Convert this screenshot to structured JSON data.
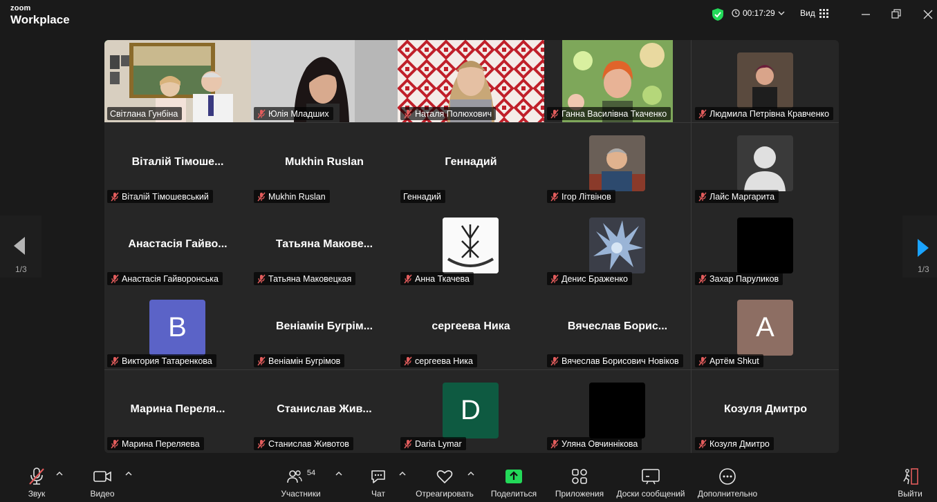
{
  "app": {
    "logo_line1": "zoom",
    "logo_line2": "Workplace"
  },
  "titlebar": {
    "timer": "00:17:29",
    "view_label": "Вид"
  },
  "nav": {
    "prev_page": "1/3",
    "next_page": "1/3"
  },
  "colors": {
    "active_speaker": "#23d959",
    "mute_icon": "#e25c5c",
    "share_button": "#23d959"
  },
  "participants": [
    {
      "name": "Світлана Гунбіна",
      "muted": false,
      "type": "video",
      "active": true
    },
    {
      "name": "Юлія Младших",
      "muted": true,
      "type": "video"
    },
    {
      "name": "Наталя Полюхович",
      "muted": true,
      "type": "video"
    },
    {
      "name": "Ганна Василівна Ткаченко",
      "muted": true,
      "type": "video"
    },
    {
      "name": "Людмила Петрівна Кравченко",
      "muted": true,
      "type": "photo"
    },
    {
      "name": "Віталій Тімошевський",
      "display": "Віталій Тімоше...",
      "muted": true,
      "type": "name"
    },
    {
      "name": "Mukhin Ruslan",
      "display": "Mukhin Ruslan",
      "muted": true,
      "type": "name"
    },
    {
      "name": "Геннадий",
      "display": "Геннадий",
      "muted": false,
      "type": "name"
    },
    {
      "name": "Ігор Літвінов",
      "muted": true,
      "type": "photo"
    },
    {
      "name": "Лайс Маргарита",
      "muted": true,
      "type": "photo",
      "avatar": "default-user-icon"
    },
    {
      "name": "Анастасія Гайворонська",
      "display": "Анастасія Гайво...",
      "muted": true,
      "type": "name"
    },
    {
      "name": "Татьяна Маковецкая",
      "display": "Татьяна  Макове...",
      "muted": true,
      "type": "name"
    },
    {
      "name": "Анна Ткачева",
      "muted": true,
      "type": "photo",
      "avatar": "rune-emblem-icon"
    },
    {
      "name": "Денис Браженко",
      "muted": true,
      "type": "photo"
    },
    {
      "name": "Захар Паруликов",
      "muted": true,
      "type": "photo",
      "avatar": "black"
    },
    {
      "name": "Виктория Татаренкова",
      "muted": true,
      "type": "letter",
      "letter": "B",
      "color": "#5b63c7"
    },
    {
      "name": "Веніамін Бугрімов",
      "display": "Веніамін  Бугрім...",
      "muted": true,
      "type": "name"
    },
    {
      "name": "сергеева Ника",
      "display": "сергеева Ника",
      "muted": true,
      "type": "name"
    },
    {
      "name": "Вячеслав Борисович Новіков",
      "display": "Вячеслав  Борис...",
      "muted": true,
      "type": "name"
    },
    {
      "name": "Артём Shkut",
      "muted": true,
      "type": "letter",
      "letter": "A",
      "color": "#8d6e63"
    },
    {
      "name": "Марина Переляева",
      "display": "Марина  Переля...",
      "muted": true,
      "type": "name"
    },
    {
      "name": "Станислав Животов",
      "display": "Станислав  Жив...",
      "muted": true,
      "type": "name"
    },
    {
      "name": "Daria Lymar",
      "muted": true,
      "type": "letter",
      "letter": "D",
      "color": "#0e5a41"
    },
    {
      "name": "Уляна Овчиннікова",
      "muted": true,
      "type": "photo",
      "avatar": "black"
    },
    {
      "name": "Козуля Дмитро",
      "display": "Козуля Дмитро",
      "muted": true,
      "type": "name"
    }
  ],
  "toolbar": {
    "audio": "Звук",
    "video": "Видео",
    "participants": "Участники",
    "participants_count": "54",
    "chat": "Чат",
    "react": "Отреагировать",
    "share": "Поделиться",
    "apps": "Приложения",
    "whiteboards": "Доски сообщений",
    "more": "Дополнительно",
    "leave": "Выйти"
  }
}
